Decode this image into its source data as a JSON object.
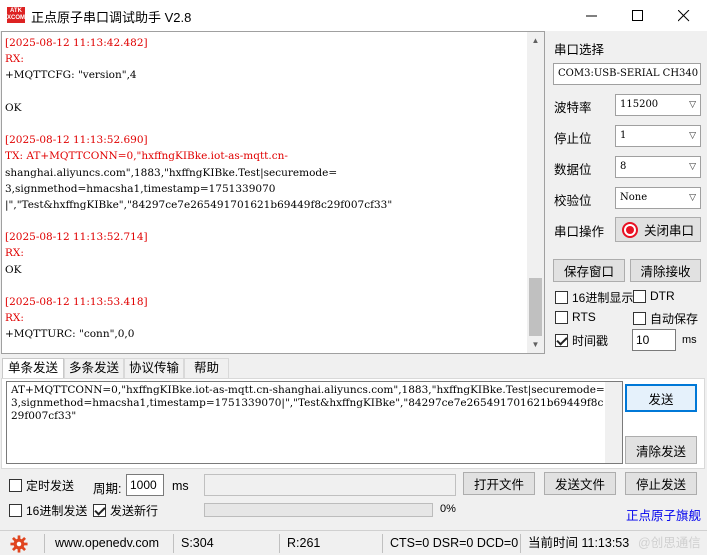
{
  "titlebar": {
    "logo_text_top": "ATK",
    "logo_text_bottom": "XCOM",
    "title": "正点原子串口调试助手 V2.8"
  },
  "log": {
    "lines": [
      {
        "text": "[2025-08-12 11:13:42.482]",
        "color": "red"
      },
      {
        "text": "RX:",
        "color": "red"
      },
      {
        "text": "+MQTTCFG: \"version\",4",
        "color": "black"
      },
      {
        "text": "",
        "color": "black"
      },
      {
        "text": "OK",
        "color": "black"
      },
      {
        "text": "",
        "color": "black"
      },
      {
        "text": "[2025-08-12 11:13:52.690]",
        "color": "red"
      },
      {
        "text": "TX: AT+MQTTCONN=0,\"hxffngKIBke.iot-as-mqtt.cn-",
        "color": "red"
      },
      {
        "text": "shanghai.aliyuncs.com\",1883,\"hxffngKIBke.Test|securemode=",
        "color": "black"
      },
      {
        "text": "3,signmethod=hmacsha1,timestamp=1751339070",
        "color": "black"
      },
      {
        "text": "|\",\"Test&hxffngKIBke\",\"84297ce7e265491701621b69449f8c29f007cf33\"",
        "color": "black"
      },
      {
        "text": "",
        "color": "black"
      },
      {
        "text": "[2025-08-12 11:13:52.714]",
        "color": "red"
      },
      {
        "text": "RX:",
        "color": "red"
      },
      {
        "text": "OK",
        "color": "black"
      },
      {
        "text": "",
        "color": "black"
      },
      {
        "text": "[2025-08-12 11:13:53.418]",
        "color": "red"
      },
      {
        "text": "RX:",
        "color": "red"
      },
      {
        "text": "+MQTTURC: \"conn\",0,0",
        "color": "black"
      }
    ]
  },
  "right_panel": {
    "port_select_label": "串口选择",
    "port_value": "COM3:USB-SERIAL CH340",
    "baud_label": "波特率",
    "baud_value": "115200",
    "stop_label": "停止位",
    "stop_value": "1",
    "data_label": "数据位",
    "data_value": "8",
    "parity_label": "校验位",
    "parity_value": "None",
    "port_op_label": "串口操作",
    "close_port_label": "关闭串口",
    "save_window_label": "保存窗口",
    "clear_recv_label": "清除接收",
    "hex_display_label": "16进制显示",
    "hex_display_checked": false,
    "dtr_label": "DTR",
    "dtr_checked": false,
    "rts_label": "RTS",
    "rts_checked": false,
    "auto_save_label": "自动保存",
    "auto_save_checked": false,
    "timestamp_label": "时间戳",
    "timestamp_checked": true,
    "timestamp_ms_value": "10",
    "ms_label": "ms"
  },
  "tabs": [
    {
      "label": "单条发送",
      "active": true
    },
    {
      "label": "多条发送",
      "active": false
    },
    {
      "label": "协议传输",
      "active": false
    },
    {
      "label": "帮助",
      "active": false
    }
  ],
  "send": {
    "text": "AT+MQTTCONN=0,\"hxffngKIBke.iot-as-mqtt.cn-shanghai.aliyuncs.com\",1883,\"hxffngKIBke.Test|securemode=3,signmethod=hmacsha1,timestamp=1751339070|\",\"Test&hxffngKIBke\",\"84297ce7e265491701621b69449f8c29f007cf33\"",
    "send_label": "发送",
    "clear_send_label": "清除发送",
    "timed_send_label": "定时发送",
    "timed_send_checked": false,
    "period_label": "周期:",
    "period_value": "1000",
    "period_unit": "ms",
    "open_file_label": "打开文件",
    "send_file_label": "发送文件",
    "stop_send_label": "停止发送",
    "hex_send_label": "16进制发送",
    "hex_send_checked": false,
    "newline_label": "发送新行",
    "newline_checked": true,
    "progress_percent": 0,
    "progress_text": "0%",
    "brand_link": "正点原子旗舰"
  },
  "statusbar": {
    "url": "www.openedv.com",
    "sent": "S:304",
    "received": "R:261",
    "lines_status": "CTS=0 DSR=0 DCD=0",
    "time": "当前时间 11:13:53",
    "watermark": "@创思通信"
  },
  "colors": {
    "accent": "#0078d7",
    "log_red": "#e00000",
    "close_port_icon": "#e81123",
    "gear": "#e0451f"
  }
}
